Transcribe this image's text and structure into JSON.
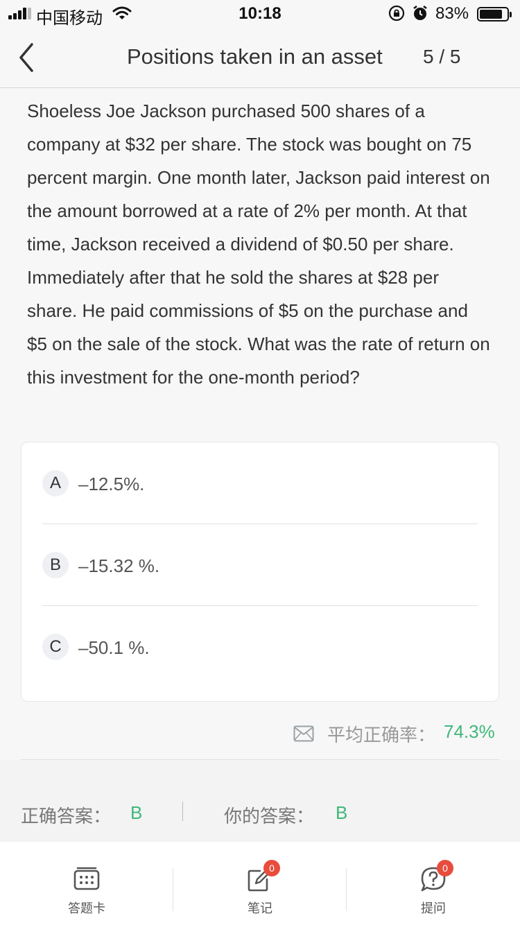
{
  "status_bar": {
    "carrier": "中国移动",
    "time": "10:18",
    "battery_percent": "83%",
    "battery_level": 0.83,
    "icons": [
      "signal-icon",
      "wifi-icon",
      "rotation-lock-icon",
      "alarm-icon",
      "battery-icon"
    ]
  },
  "nav": {
    "title": "Positions taken in an asset",
    "progress": "5 / 5",
    "back_icon": "chevron-left-icon"
  },
  "question": {
    "text": "Shoeless Joe Jackson purchased 500 shares of a company at $32 per share. The stock was bought on 75 percent margin. One month later, Jackson paid interest on the amount borrowed at a rate of 2% per month. At that time, Jackson received a dividend of $0.50 per share. Immediately after that he sold the shares at $28 per share. He paid commissions of $5 on the purchase and $5 on the sale of the stock. What was the rate of return on this investment for the one-month period?"
  },
  "options": [
    {
      "letter": "A",
      "text": "–12.5%."
    },
    {
      "letter": "B",
      "text": "–15.32 %."
    },
    {
      "letter": "C",
      "text": "–50.1 %."
    }
  ],
  "stats": {
    "icon": "envelope-icon",
    "avg_label": "平均正确率：",
    "avg_value": "74.3%"
  },
  "answer": {
    "correct_label": "正确答案：",
    "correct_value": "B",
    "yours_label": "你的答案：",
    "yours_value": "B"
  },
  "tabs": [
    {
      "label": "答题卡",
      "icon": "answer-card-icon"
    },
    {
      "label": "笔记",
      "icon": "note-edit-icon",
      "badge": "0"
    },
    {
      "label": "提问",
      "icon": "question-bubble-icon",
      "badge": "0"
    }
  ],
  "colors": {
    "accent_green": "#3fb87a",
    "badge_red": "#e84c3d"
  }
}
